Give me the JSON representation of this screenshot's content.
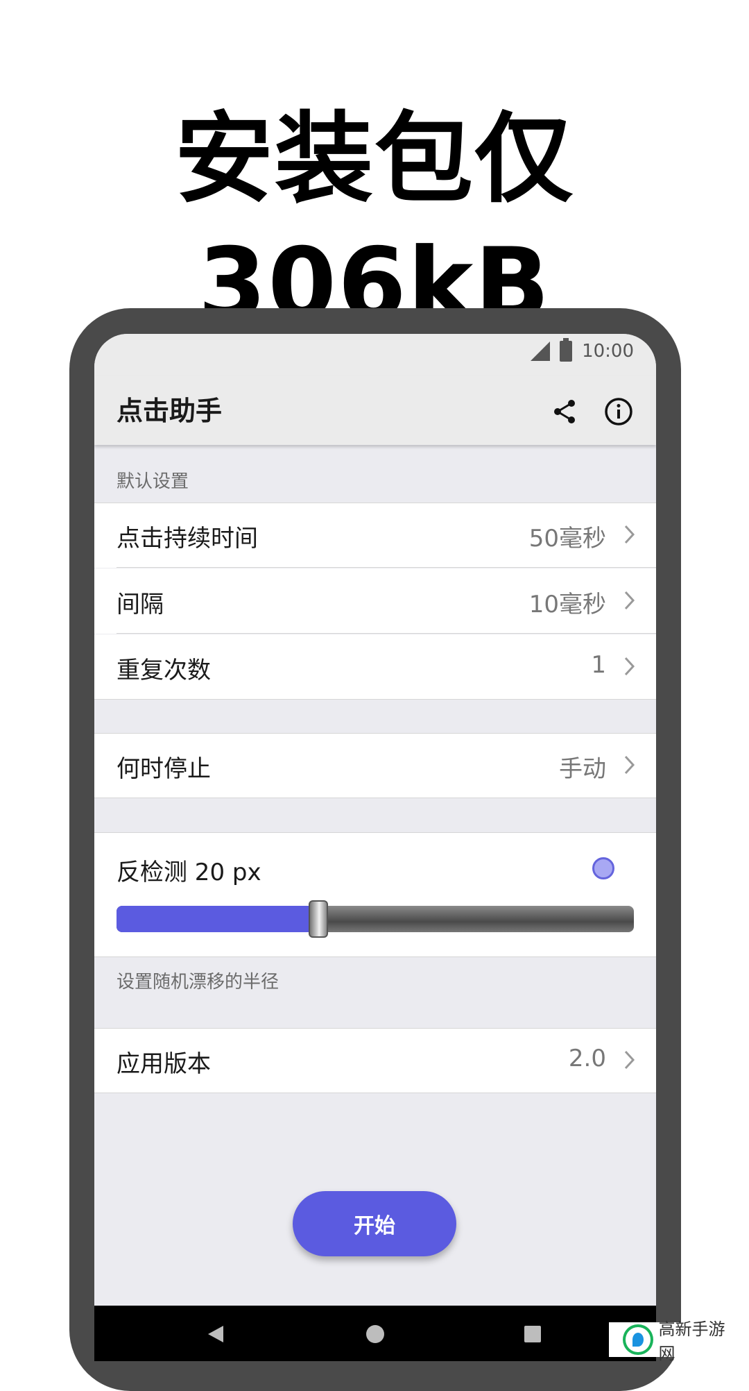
{
  "headline": "安装包仅306kB",
  "status_bar": {
    "time": "10:00",
    "signal_icon": "cell-signal-icon",
    "battery_icon": "battery-icon"
  },
  "app_bar": {
    "title": "点击助手",
    "share_icon": "share-icon",
    "info_icon": "info-icon"
  },
  "sections": {
    "default_header": "默认设置",
    "slider_hint": "设置随机漂移的半径"
  },
  "rows": {
    "duration": {
      "label": "点击持续时间",
      "value": "50毫秒"
    },
    "interval": {
      "label": "间隔",
      "value": "10毫秒"
    },
    "repeat": {
      "label": "重复次数",
      "value": "1"
    },
    "stop": {
      "label": "何时停止",
      "value": "手动"
    },
    "version": {
      "label": "应用版本",
      "value": "2.0"
    }
  },
  "anti_detect": {
    "label": "反检测 20 px",
    "slider_fraction": 0.39
  },
  "start_button": {
    "label": "开始"
  },
  "nav_bar": {
    "back_icon": "back-triangle-icon",
    "home_icon": "home-circle-icon",
    "recents_icon": "recents-square-icon"
  },
  "watermark": {
    "text": "高新手游网"
  },
  "colors": {
    "accent": "#5b5be0",
    "background": "#ebebf0"
  }
}
